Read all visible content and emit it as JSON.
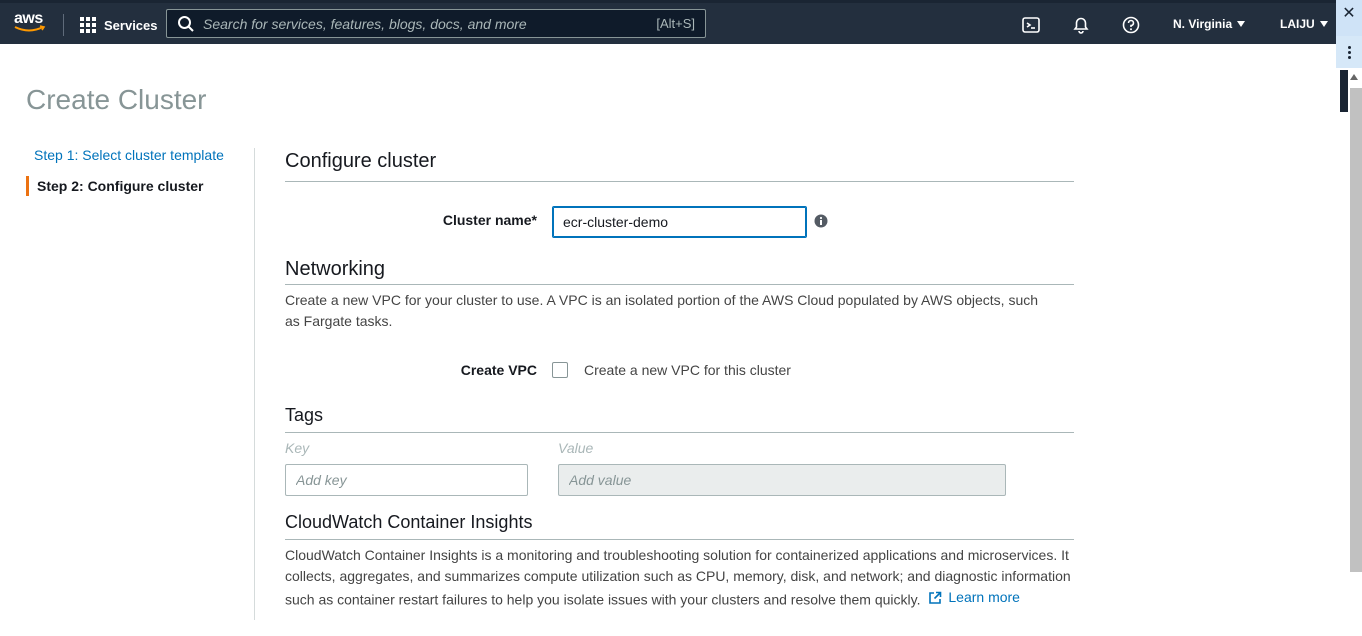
{
  "nav": {
    "logo_text": "aws",
    "services_label": "Services",
    "search_placeholder": "Search for services, features, blogs, docs, and more",
    "search_shortcut": "[Alt+S]",
    "region_label": "N. Virginia",
    "user_label": "LAIJU",
    "icons": [
      "cloudshell-icon",
      "bell-icon",
      "help-icon"
    ]
  },
  "page": {
    "title": "Create Cluster"
  },
  "steps": [
    {
      "label": "Step 1: Select cluster template",
      "active": false
    },
    {
      "label": "Step 2: Configure cluster",
      "active": true
    }
  ],
  "configure": {
    "title": "Configure cluster",
    "cluster_name_label": "Cluster name*",
    "cluster_name_value": "ecr-cluster-demo"
  },
  "networking": {
    "title": "Networking",
    "description": "Create a new VPC for your cluster to use. A VPC is an isolated portion of the AWS Cloud populated by AWS objects, such as Fargate tasks.",
    "create_vpc_label": "Create VPC",
    "create_vpc_checkbox_label": "Create a new VPC for this cluster",
    "create_vpc_checked": false
  },
  "tags": {
    "title": "Tags",
    "key_header": "Key",
    "value_header": "Value",
    "key_placeholder": "Add key",
    "value_placeholder": "Add value"
  },
  "insights": {
    "title": "CloudWatch Container Insights",
    "description": "CloudWatch Container Insights is a monitoring and troubleshooting solution for containerized applications and microservices. It collects, aggregates, and summarizes compute utilization such as CPU, memory, disk, and network; and diagnostic information such as container restart failures to help you isolate issues with your clusters and resolve them quickly.",
    "learn_more": "Learn more"
  },
  "colors": {
    "nav_bg": "#232f3e",
    "link": "#0073bb",
    "active_step_border": "#ec7211",
    "title_gray": "#879596"
  }
}
